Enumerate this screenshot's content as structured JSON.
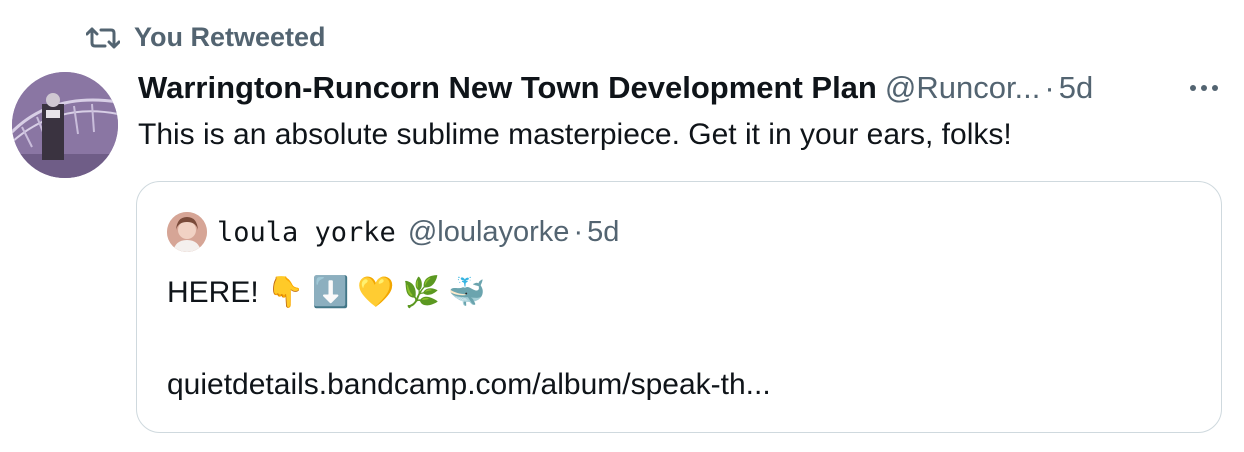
{
  "retweet": {
    "label": "You Retweeted",
    "icon": "retweet-icon"
  },
  "tweet": {
    "author_name": "Warrington-Runcorn New Town Development Plan",
    "author_handle": "@Runcor...",
    "separator": "·",
    "time": "5d",
    "text": "This is an absolute sublime masterpiece. Get it in your ears, folks!",
    "more_icon": "more-icon"
  },
  "quote": {
    "author_name": "loula yorke",
    "author_handle": "@loulayorke",
    "separator": "·",
    "time": "5d",
    "text_prefix": "HERE!",
    "emojis": [
      "👇",
      "⬇️",
      "💛",
      "🌿",
      "🐳"
    ],
    "link": "quietdetails.bandcamp.com/album/speak-th..."
  },
  "colors": {
    "secondary_text": "#536471",
    "primary_text": "#0f1419",
    "border": "#cfd9de"
  }
}
